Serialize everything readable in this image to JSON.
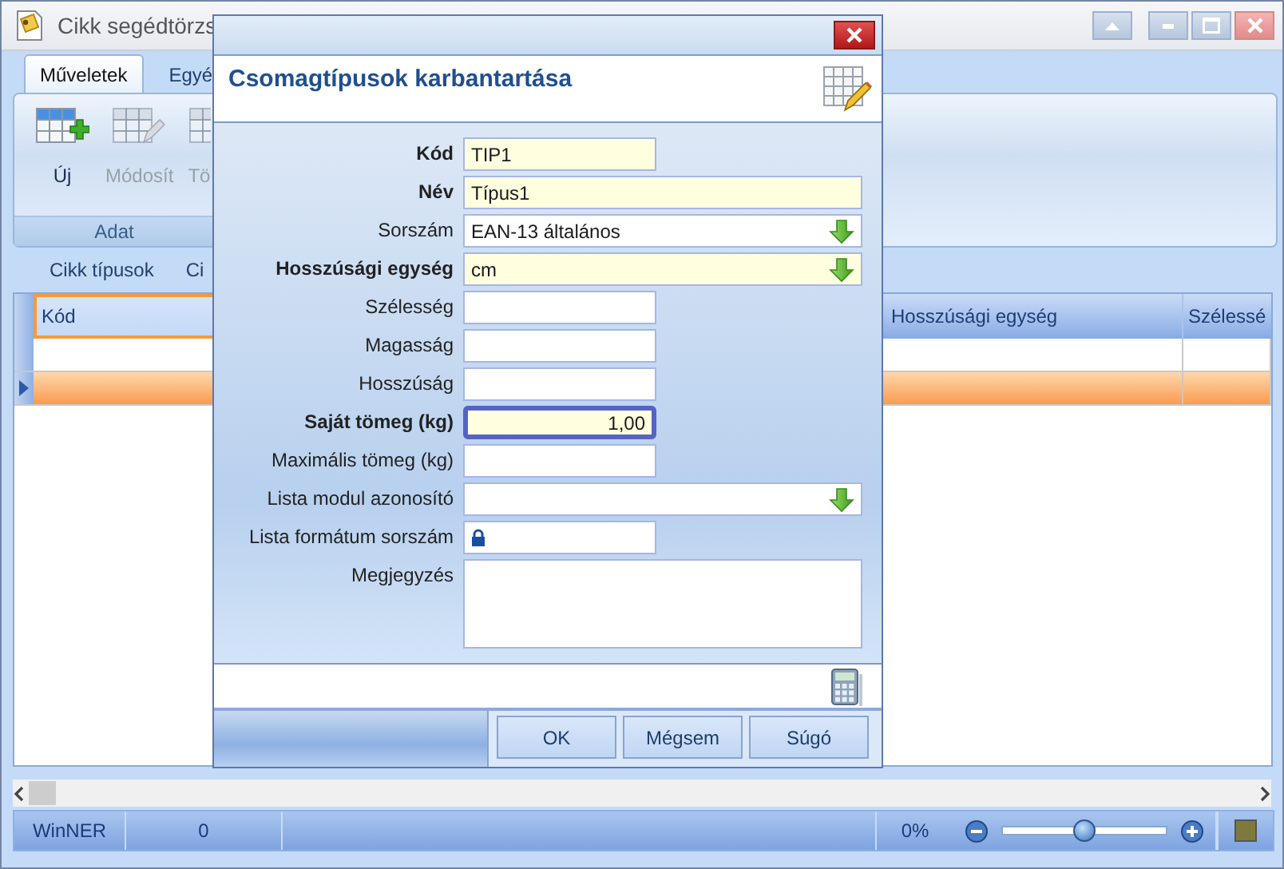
{
  "window": {
    "title": "Cikk segédtörzs"
  },
  "ribbon": {
    "tabs": [
      {
        "label": "Műveletek",
        "selected": true
      },
      {
        "label": "Egyé",
        "selected": false
      }
    ],
    "group": "Adat",
    "buttons": [
      {
        "label": "Új",
        "disabled": false
      },
      {
        "label": "Módosít",
        "disabled": true
      },
      {
        "label": "Tö",
        "disabled": true
      }
    ]
  },
  "sub_tabs": [
    {
      "label": "Cikk típusok",
      "selected": false
    },
    {
      "label": "Ci",
      "selected": false
    }
  ],
  "table": {
    "columns": [
      "Kód",
      "Hosszúsági egység",
      "Szélessé"
    ],
    "rows": [
      {
        "selected": false
      },
      {
        "selected": true
      }
    ]
  },
  "status_bar": {
    "app": "WinNER",
    "count": "0",
    "zoom": "0%",
    "zoom_slider": {
      "level": 0.5
    }
  },
  "dialog": {
    "title": "Csomagtípusok karbantartása",
    "fields": [
      {
        "label": "Kód",
        "value": "TIP1",
        "kind": "short",
        "required": true,
        "focused": false
      },
      {
        "label": "Név",
        "value": "Típus1",
        "kind": "wide",
        "required": true,
        "focused": false
      },
      {
        "label": "Sorszám",
        "value": "EAN-13 általános",
        "kind": "dropdown",
        "required": false,
        "focused": false
      },
      {
        "label": "Hosszúsági egység",
        "value": "cm",
        "kind": "dropdown",
        "required": true,
        "focused": false
      },
      {
        "label": "Szélesség",
        "kind": "short",
        "required": false,
        "focused": false
      },
      {
        "label": "Magasság",
        "kind": "short",
        "required": false,
        "focused": false
      },
      {
        "label": "Hosszúság",
        "kind": "short",
        "required": false,
        "focused": false
      },
      {
        "label": "Saját tömeg (kg)",
        "value": "1,00",
        "kind": "number",
        "required": true,
        "focused": true
      },
      {
        "label": "Maximális tömeg (kg)",
        "kind": "number",
        "required": false,
        "focused": false
      },
      {
        "label": "Lista modul azonosító",
        "kind": "dropdown",
        "required": false,
        "focused": false
      },
      {
        "label": "Lista formátum sorszám",
        "kind": "locked",
        "required": false,
        "focused": false
      },
      {
        "label": "Megjegyzés",
        "kind": "memo",
        "required": false,
        "focused": false
      }
    ],
    "buttons": [
      "OK",
      "Mégsem",
      "Súgó"
    ]
  }
}
